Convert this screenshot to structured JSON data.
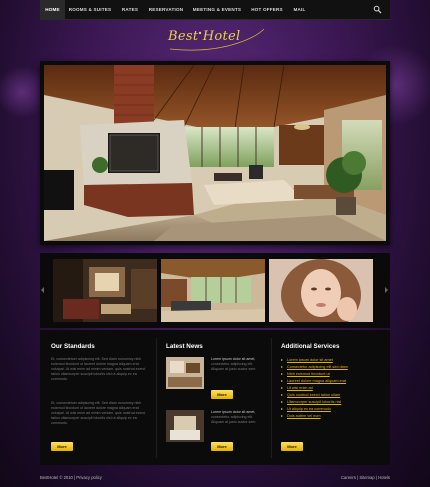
{
  "nav": {
    "items": [
      {
        "label": "Home"
      },
      {
        "label": "Rooms & Suites"
      },
      {
        "label": "Rates"
      },
      {
        "label": "Reservation"
      },
      {
        "label": "Meeting & Events"
      },
      {
        "label": "Hot Offers"
      },
      {
        "label": "Mail"
      }
    ],
    "active_index": 0,
    "search_icon": "search-icon"
  },
  "logo": {
    "text": "Best Hotel"
  },
  "thumbs": [
    {
      "icon": "interior-photo"
    },
    {
      "icon": "sunroom-photo"
    },
    {
      "icon": "woman-portrait-photo"
    }
  ],
  "standards": {
    "title": "Our Standards",
    "para1": "Et, consectetuer adipiscing elit. Sed diam nonummy nibh euismod tincidunt ut laoreet dolore magna aliquam erat volutpat. Ut wisi enim ad minim veniam, quis nostrud exerci tation ullamcorper suscipit lobortis nisl ut aliquip ex ea commodo.",
    "para2": "Et, consectetuer adipiscing elit. Sed diam nonummy nibh euismod tincidunt ut laoreet dolore magna aliquam erat volutpat. Ut wisi enim ad minim veniam, quis nostrud exerci tation ullamcorper suscipit lobortis nisl ut aliquip ex ea commodo.",
    "button": "More"
  },
  "news": {
    "title": "Latest News",
    "items": [
      {
        "lead": "Lorem ipsum dolor sit amet,",
        "text": "consectetur adipiscing elit. Aliquam at justo auctor sem.",
        "button": "More"
      },
      {
        "lead": "Lorem ipsum dolor sit amet,",
        "text": "consectetur adipiscing elit. Aliquam at justo auctor sem.",
        "button": "More"
      }
    ]
  },
  "services": {
    "title": "Additional Services",
    "items": [
      "Lorem ipsum dolor sit amet",
      "Consectetur adipiscing elit sed diam",
      "Nibh euismod tincidunt ut",
      "Laoreet dolore magna aliquam erat",
      "Ut wisi enim ad",
      "Quis nostrud exerci tation ullam",
      "Ullamcorper suscipit lobortis nisl",
      "Ut aliquip ex ea commodo",
      "Duis autem vel eum"
    ],
    "button": "More"
  },
  "footer": {
    "left": "BestHotel © 2010  |  Privacy policy",
    "right": "Careers  |  Sitemap  |  Hotels"
  },
  "colors": {
    "accent": "#e0b200",
    "background": "#3a1752",
    "panel": "#0b0b0b"
  }
}
